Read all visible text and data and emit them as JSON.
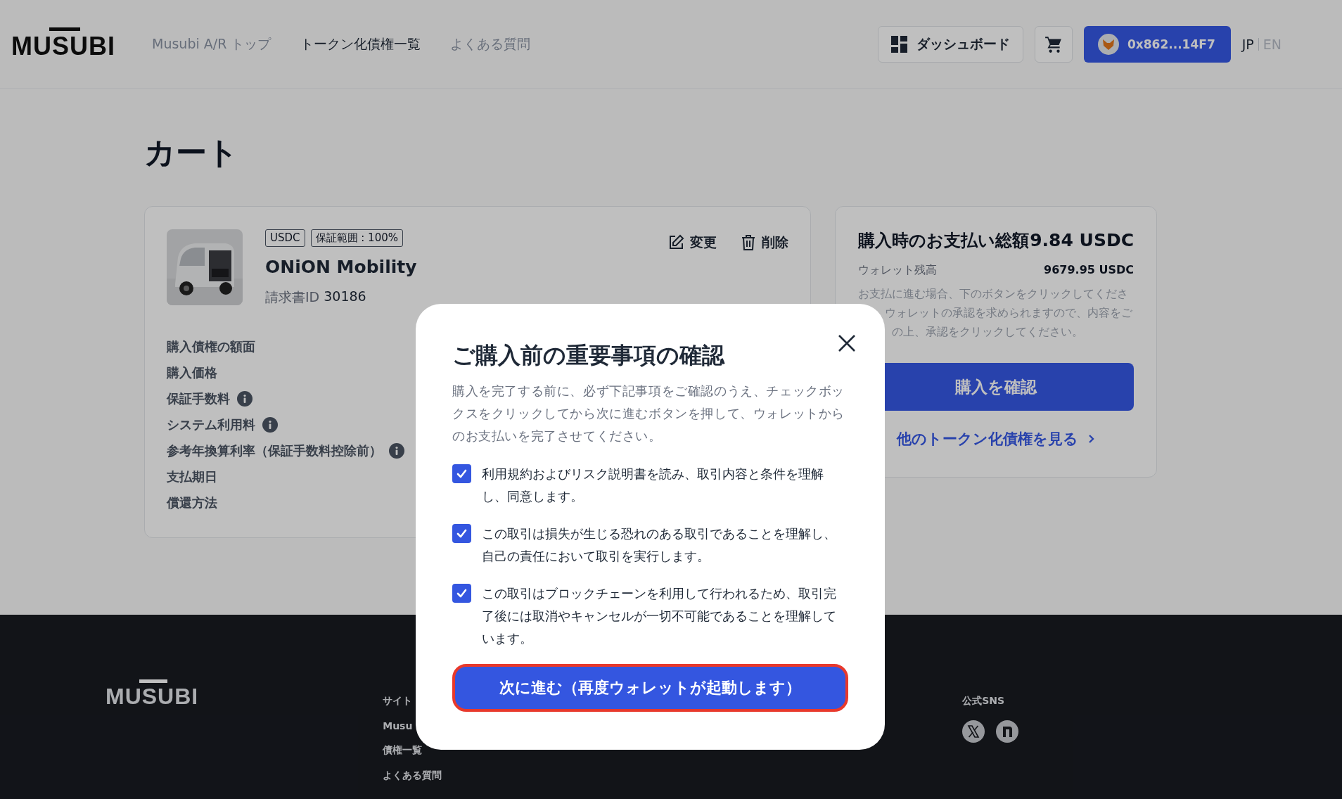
{
  "header": {
    "logo": "MUSUBI",
    "nav": [
      {
        "label": "Musubi A/R トップ",
        "selected": false
      },
      {
        "label": "トークン化債権一覧",
        "selected": true
      },
      {
        "label": "よくある質問",
        "selected": false
      }
    ],
    "dashboard_button": "ダッシュボード",
    "wallet_button": "0x862...14F7",
    "languages": [
      {
        "label": "JP",
        "selected": true
      },
      {
        "label": "EN",
        "selected": false
      }
    ]
  },
  "page_title": "カート",
  "cart_item": {
    "tags": [
      "USDC",
      "保証範囲 : 100%"
    ],
    "name": "ONiON Mobility",
    "invoice_label": "請求書ID",
    "invoice_id": "30186",
    "actions": [
      {
        "label": "変更",
        "kind": "edit"
      },
      {
        "label": "削除",
        "kind": "delete"
      }
    ],
    "fields": [
      {
        "label": "購入債権の額面",
        "info": false
      },
      {
        "label": "購入価格",
        "info": false
      },
      {
        "label": "保証手数料",
        "info": true
      },
      {
        "label": "システム利用料",
        "info": true
      },
      {
        "label": "参考年換算利率（保証手数料控除前）",
        "info": true
      },
      {
        "label": "支払期日",
        "info": false
      },
      {
        "label": "償還方法",
        "info": false
      }
    ]
  },
  "summary": {
    "title": "購入時のお支払い総額",
    "total": "9.84 USDC",
    "balance_label": "ウォレット残高",
    "balance": "9679.95 USDC",
    "note_lines": [
      "お支払に進む場合、下のボタンをクリックしてくださ",
      "ウォレットの承認を求められますので、内容をご",
      "の上、承認をクリックしてください。"
    ],
    "confirm_button": "購入を確認",
    "more_link": "他のトークン化債権を見る"
  },
  "footer": {
    "logo": "MUSUBI",
    "sitemap_heading": "サイト",
    "links": [
      "Musu",
      "債権一覧",
      "よくある質問"
    ],
    "sns_heading": "公式SNS",
    "sns": [
      {
        "kind": "x"
      },
      {
        "kind": "n"
      }
    ]
  },
  "modal": {
    "title": "ご購入前の重要事項の確認",
    "description": "購入を完了する前に、必ず下記事項をご確認のうえ、チェックボックスをクリックしてから次に進むボタンを押して、ウォレットからのお支払いを完了させてください。",
    "items": [
      {
        "text": "利用規約およびリスク説明書を読み、取引内容と条件を理解し、同意します。",
        "checked": true
      },
      {
        "text": "この取引は損失が生じる恐れのある取引であることを理解し、自己の責任において取引を実行します。",
        "checked": true
      },
      {
        "text": "この取引はブロックチェーンを利用して行われるため、取引完了後には取消やキャンセルが一切不可能であることを理解しています。",
        "checked": true
      }
    ],
    "next_button": "次に進む（再度ウォレットが起動します）"
  }
}
